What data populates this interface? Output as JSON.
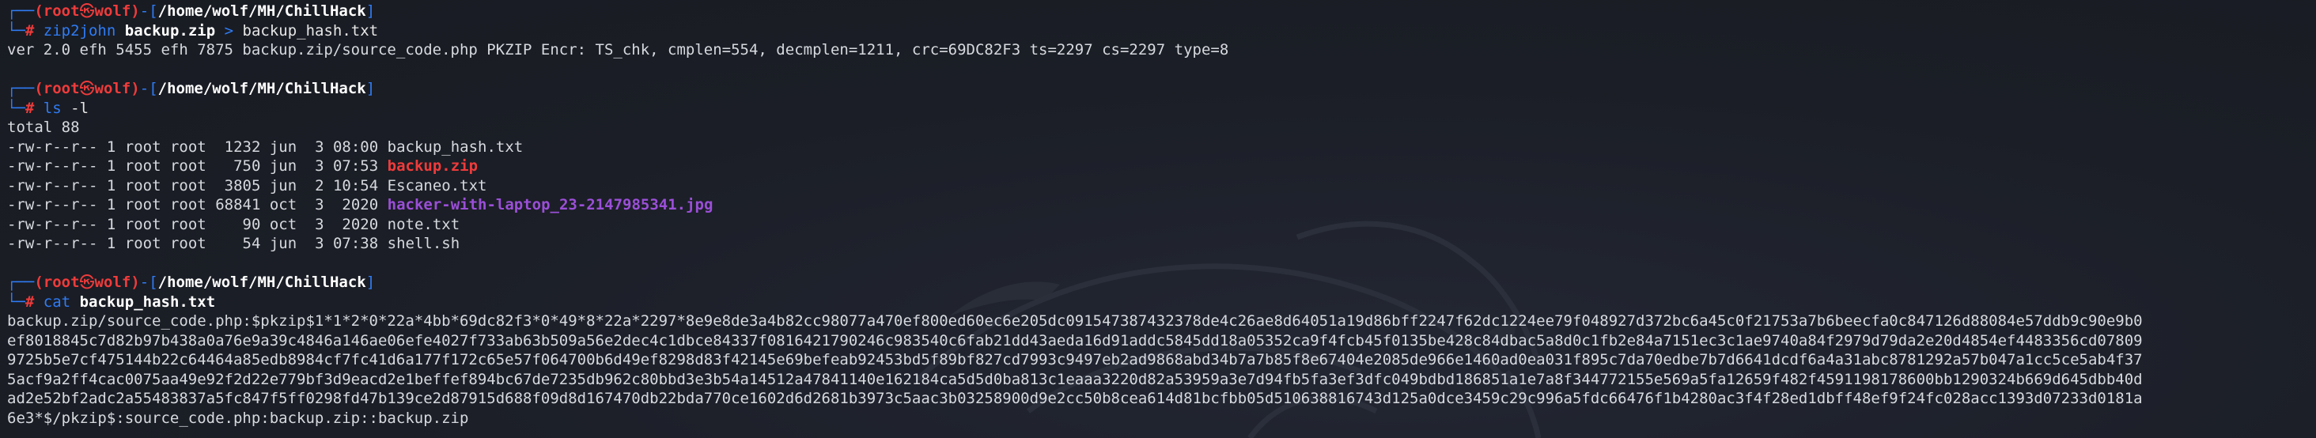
{
  "prompt": {
    "box_top": "┌──",
    "box_bottom": "└─",
    "hash": "#",
    "user": "(root",
    "skull": "㉿",
    "host": "wolf)",
    "dash": "-[",
    "path": "/home/wolf/MH/ChillHack",
    "close": "]"
  },
  "blocks": [
    {
      "command": {
        "name": "zip2john",
        "arg1": "backup.zip",
        "op": ">",
        "arg2": "backup_hash.txt"
      },
      "output": [
        "ver 2.0 efh 5455 efh 7875 backup.zip/source_code.php PKZIP Encr: TS_chk, cmplen=554, decmplen=1211, crc=69DC82F3 ts=2297 cs=2297 type=8"
      ]
    },
    {
      "command": {
        "name": "ls",
        "arg1": "-l"
      },
      "total": "total 88",
      "files": [
        {
          "perm": "-rw-r--r--",
          "links": "1",
          "owner": "root",
          "group": "root",
          "size": " 1232",
          "month": "jun",
          "day": " 3",
          "time": "08:00",
          "name": "backup_hash.txt",
          "style": "out"
        },
        {
          "perm": "-rw-r--r--",
          "links": "1",
          "owner": "root",
          "group": "root",
          "size": "  750",
          "month": "jun",
          "day": " 3",
          "time": "07:53",
          "name": "backup.zip",
          "style": "file-red"
        },
        {
          "perm": "-rw-r--r--",
          "links": "1",
          "owner": "root",
          "group": "root",
          "size": " 3805",
          "month": "jun",
          "day": " 2",
          "time": "10:54",
          "name": "Escaneo.txt",
          "style": "out"
        },
        {
          "perm": "-rw-r--r--",
          "links": "1",
          "owner": "root",
          "group": "root",
          "size": "68841",
          "month": "oct",
          "day": " 3",
          "time": " 2020",
          "name": "hacker-with-laptop_23-2147985341.jpg",
          "style": "file-purple"
        },
        {
          "perm": "-rw-r--r--",
          "links": "1",
          "owner": "root",
          "group": "root",
          "size": "   90",
          "month": "oct",
          "day": " 3",
          "time": " 2020",
          "name": "note.txt",
          "style": "out"
        },
        {
          "perm": "-rw-r--r--",
          "links": "1",
          "owner": "root",
          "group": "root",
          "size": "   54",
          "month": "jun",
          "day": " 3",
          "time": "07:38",
          "name": "shell.sh",
          "style": "out"
        }
      ]
    },
    {
      "command": {
        "name": "cat",
        "arg1": "backup_hash.txt"
      },
      "hash_lines": [
        "backup.zip/source_code.php:$pkzip$1*1*2*0*22a*4bb*69dc82f3*0*49*8*22a*2297*8e9e8de3a4b82cc98077a470ef800ed60ec6e205dc091547387432378de4c26ae8d64051a19d86bff2247f62dc1224ee79f048927d372bc6a45c0f21753a7b6beecfa0c847126d88084e57ddb9c90e9b0",
        "ef8018845c7d82b97b438a0a76e9a39c4846a146ae06efe4027f733ab63b509a56e2dec4c1dbce84337f0816421790246c983540c6fab21dd43aeda16d91addc5845dd18a05352ca9f4fcb45f0135be428c84dbac5a8d0c1fb2e84a7151ec3c1ae9740a84f2979d79da2e20d4854ef4483356cd07809",
        "9725b5e7cf475144b22c64464a85edb8984cf7fc41d6a177f172c65e57f064700b6d49ef8298d83f42145e69befeab92453bd5f89bf827cd7993c9497eb2ad9868abd34b7a7b85f8e67404e2085de966e1460ad0ea031f895c7da70edbe7b7d6641dcdf6a4a31abc8781292a57b047a1cc5ce5ab4f37",
        "5acf9a2ff4cac0075aa49e92f2d22e779bf3d9eacd2e1beffef894bc67de7235db962c80bbd3e3b54a14512a47841140e162184ca5d5d0ba813c1eaaa3220d82a53959a3e7d94fb5fa3ef3dfc049bdbd186851a1e7a8f344772155e569a5fa12659f482f4591198178600bb1290324b669d645dbb40d",
        "ad2e52bf2adc2a55483837a5fc847f5ff0298fd47b139ce2d87915d688f09d8d167470db22bda770ce1602d6d2681b3973c5aac3b03258900d9e2cc50b8cea614d81bcfbb05d510638816743d125a0dce3459c29c996a5fdc66476f1b4280ac3f4f28ed1dbff48ef9f24fc028acc1393d07233d0181a",
        "6e3*$/pkzip$:source_code.php:backup.zip::backup.zip"
      ]
    }
  ],
  "colors": {
    "background": "#1b1e26",
    "prompt_red": "#ef3b3b",
    "command_blue": "#2f7cf6",
    "image_file_purple": "#9b4fd8"
  }
}
